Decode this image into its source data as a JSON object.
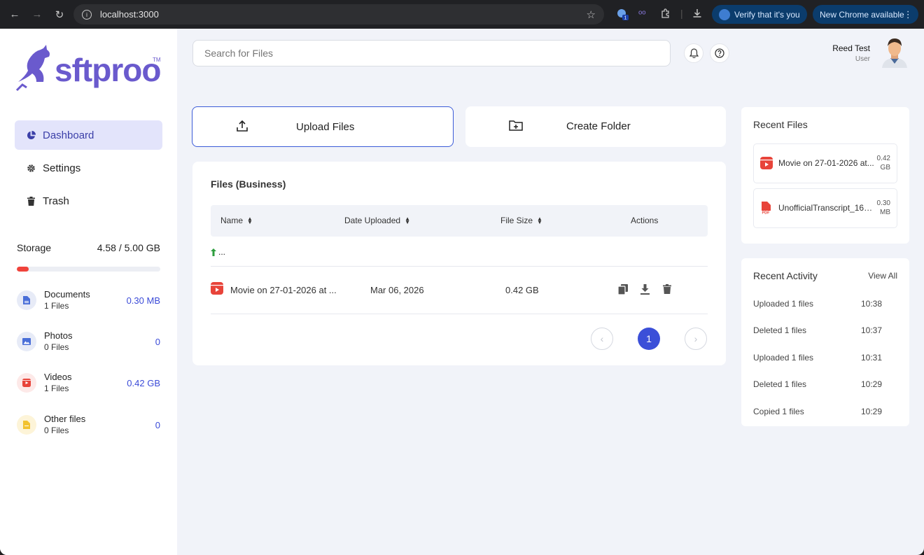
{
  "browser": {
    "url": "localhost:3000",
    "extension_badge": "1",
    "verify_label": "Verify that it's you",
    "update_label": "New Chrome available"
  },
  "brand": {
    "logo_text": "sftproo",
    "tm": "TM"
  },
  "sidebar": {
    "menu": [
      {
        "label": "Dashboard",
        "icon": "pie-chart-icon",
        "active": true
      },
      {
        "label": "Settings",
        "icon": "gear-icon",
        "active": false
      },
      {
        "label": "Trash",
        "icon": "trash-icon",
        "active": false
      }
    ],
    "storage": {
      "label": "Storage",
      "value": "4.58 / 5.00 GB",
      "used_fraction": 0.084
    },
    "categories": [
      {
        "name": "Documents",
        "count": "1 Files",
        "size": "0.30 MB",
        "icon": "document-icon",
        "color": "#4a6fd8"
      },
      {
        "name": "Photos",
        "count": "0 Files",
        "size": "0",
        "icon": "image-icon",
        "color": "#4a6fd8"
      },
      {
        "name": "Videos",
        "count": "1 Files",
        "size": "0.42 GB",
        "icon": "video-icon",
        "color": "#e8443a"
      },
      {
        "name": "Other files",
        "count": "0 Files",
        "size": "0",
        "icon": "file-icon",
        "color": "#f2c230"
      }
    ]
  },
  "header": {
    "search_placeholder": "Search for Files",
    "user_name": "Reed Test",
    "user_role": "User"
  },
  "actions": {
    "upload_label": "Upload Files",
    "create_label": "Create Folder"
  },
  "files": {
    "title": "Files (Business)",
    "columns": [
      "Name",
      "Date Uploaded",
      "File Size",
      "Actions"
    ],
    "up_label": "...",
    "rows": [
      {
        "name": "Movie on 27-01-2026 at ...",
        "date": "Mar 06, 2026",
        "size": "0.42 GB"
      }
    ],
    "current_page": "1"
  },
  "recent_files": {
    "title": "Recent Files",
    "items": [
      {
        "name": "Movie on 27-01-2026 at...",
        "size_value": "0.42",
        "size_unit": "GB",
        "icon": "video-icon"
      },
      {
        "name": "UnofficialTranscript_169...",
        "size_value": "0.30",
        "size_unit": "MB",
        "icon": "pdf-icon"
      }
    ]
  },
  "recent_activity": {
    "title": "Recent Activity",
    "view_all": "View All",
    "items": [
      {
        "text": "Uploaded 1 files",
        "time": "10:38"
      },
      {
        "text": "Deleted 1 files",
        "time": "10:37"
      },
      {
        "text": "Uploaded 1 files",
        "time": "10:31"
      },
      {
        "text": "Deleted 1 files",
        "time": "10:29"
      },
      {
        "text": "Copied 1 files",
        "time": "10:29"
      }
    ]
  },
  "colors": {
    "accent": "#3b4fd8",
    "active_bg": "#e3e4fb",
    "logo": "#6a5acd",
    "storage_fill": "#f0433b",
    "app_bg": "#f1f3f9"
  }
}
